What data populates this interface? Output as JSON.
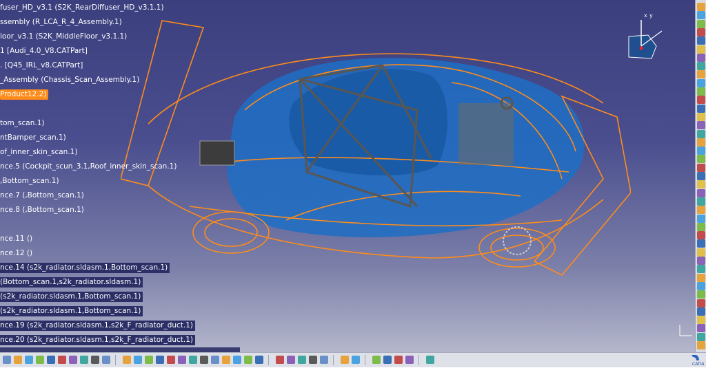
{
  "tree": {
    "nodes": [
      {
        "label": "fuser_HD_v3.1 (S2K_RearDiffuser_HD_v3.1.1)",
        "style": "plain"
      },
      {
        "label": "ssembly (R_LCA_R_4_Assembly.1)",
        "style": "plain"
      },
      {
        "label": "loor_v3.1 (S2K_MiddleFloor_v3.1.1)",
        "style": "plain"
      },
      {
        "label": "1 [Audi_4.0_V8.CATPart]",
        "style": "plain"
      },
      {
        "label": ". [Q45_IRL_v8.CATPart]",
        "style": "plain"
      },
      {
        "label": "_Assembly (Chassis_Scan_Assembly.1)",
        "style": "plain"
      },
      {
        "label": "Product12.2)",
        "style": "highlight"
      },
      {
        "label": "",
        "style": "plain"
      },
      {
        "label": "tom_scan.1)",
        "style": "plain"
      },
      {
        "label": "ntBamper_scan.1)",
        "style": "plain"
      },
      {
        "label": "of_inner_skin_scan.1)",
        "style": "plain"
      },
      {
        "label": "nce.5 (Cockpit_scun_3.1,Roof_inner_skin_scan.1)",
        "style": "plain"
      },
      {
        "label": ",Bottom_scan.1)",
        "style": "plain"
      },
      {
        "label": "nce.7 (,Bottom_scan.1)",
        "style": "plain"
      },
      {
        "label": "nce.8 (,Bottom_scan.1)",
        "style": "plain"
      },
      {
        "label": "",
        "style": "plain"
      },
      {
        "label": "nce.11 ()",
        "style": "plain"
      },
      {
        "label": "nce.12 ()",
        "style": "plain"
      },
      {
        "label": "nce.14 (s2k_radiator.sldasm.1,Bottom_scan.1)",
        "style": "selected"
      },
      {
        "label": "(Bottom_scan.1,s2k_radiator.sldasm.1)",
        "style": "selected"
      },
      {
        "label": "(s2k_radiator.sldasm.1,Bottom_scan.1)",
        "style": "selected"
      },
      {
        "label": "(s2k_radiator.sldasm.1,Bottom_scan.1)",
        "style": "selected"
      },
      {
        "label": "nce.19 (s2k_radiator.sldasm.1,s2k_F_radiator_duct.1)",
        "style": "selected"
      },
      {
        "label": "nce.20 (s2k_radiator.sldasm.1,s2k_F_radiator_duct.1)",
        "style": "selected"
      }
    ]
  },
  "compass": {
    "axis_x": "x",
    "axis_y": "y"
  },
  "status": {
    "text": "                                                                                                    "
  },
  "logo": {
    "text": "CATIA"
  },
  "colors": {
    "wireframe": "#ff8c1a",
    "body": "#1f6fc4",
    "highlight": "#ff8c1a",
    "background_top": "#3b3f7e",
    "background_bottom": "#b5b7cc"
  },
  "icons": {
    "right_toolbar": [
      "cursor-icon",
      "sketch-icon",
      "part-icon",
      "assembly-icon",
      "constraint-icon",
      "measure-icon",
      "analysis-icon",
      "section-icon",
      "clash-icon",
      "explode-icon",
      "snap-icon",
      "manipulate-icon",
      "bom-icon",
      "update-icon",
      "catalog-icon",
      "publish-icon",
      "scene-icon",
      "render-icon",
      "annotation-icon",
      "weld-icon",
      "hole-icon",
      "pattern-icon",
      "mirror-icon",
      "offset-icon",
      "fix-icon",
      "contact-icon",
      "coincidence-icon",
      "angle-icon",
      "reuse-icon",
      "replace-icon",
      "compass-icon",
      "views-icon",
      "light-icon",
      "material-icon",
      "hide-icon",
      "swap-icon",
      "fit-icon",
      "pan-icon",
      "rotate-icon",
      "zoom-icon",
      "dimension-icon"
    ],
    "bottom_toolbar": [
      "new-icon",
      "open-icon",
      "save-icon",
      "print-icon",
      "cut-icon",
      "copy-icon",
      "paste-icon",
      "undo-icon",
      "redo-icon",
      "whats-this-icon",
      "fly-icon",
      "fit-all-icon",
      "pan-icon",
      "rotate-icon",
      "zoom-in-icon",
      "zoom-out-icon",
      "normal-view-icon",
      "multi-view-icon",
      "iso-view-icon",
      "shading-icon",
      "hide-show-icon",
      "swap-space-icon",
      "cube-icon",
      "render-style-icon",
      "update-icon",
      "manipulation-icon",
      "explode-icon",
      "snap-icon",
      "measure-icon",
      "analysis-icon",
      "material-icon",
      "apply-material-icon",
      "scene-icon",
      "lights-icon",
      "grid-icon"
    ]
  }
}
